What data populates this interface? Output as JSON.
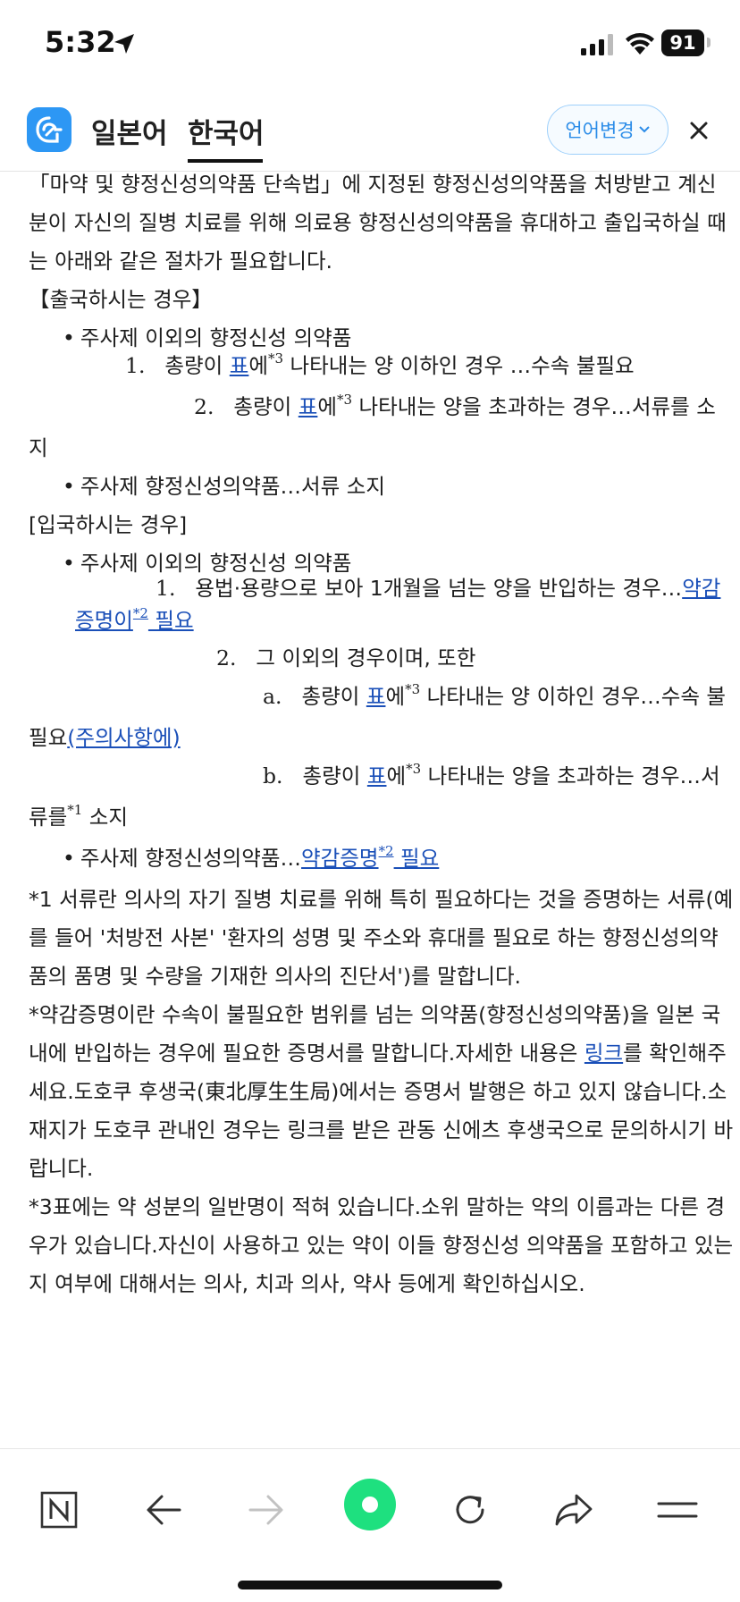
{
  "status_bar": {
    "time": "5:32",
    "battery": "91"
  },
  "header": {
    "tab_japanese": "일본어",
    "tab_korean": "한국어",
    "language_change": "언어변경",
    "colors": {
      "accent": "#2d97f4",
      "link": "#1a4fb8"
    }
  },
  "content": {
    "intro": "「마약 및 향정신성의약품 단속법」에 지정된 향정신성의약품을 처방받고 계신 분이 자신의 질병 치료를 위해 의료용 향정신성의약품을 휴대하고 출입국하실 때는 아래와 같은 절차가 필요합니다.",
    "departure_heading": "【출국하시는 경우】",
    "dep_bullet1": "주사제 이외의 향정신성 의약품",
    "dep_item1_num": "1.",
    "dep_item1_pre": "총량이 ",
    "dep_item1_link": "표",
    "dep_item1_mid": "에",
    "dep_item1_sup": "*3",
    "dep_item1_post": " 나타내는 양 이하인 경우 …수속 불필요",
    "dep_item2_num": "2.",
    "dep_item2_pre": "총량이 ",
    "dep_item2_link": "표",
    "dep_item2_mid": "에",
    "dep_item2_sup": "*3",
    "dep_item2_post": " 나타내는 양을 초과하는 경우…서류를 소지",
    "dep_bullet2": "주사제 향정신성의약품…서류 소지",
    "entry_heading": "[입국하시는 경우]",
    "ent_bullet1": "주사제 이외의 향정신성 의약품",
    "ent_item1_num": "1.",
    "ent_item1_text": "용법·용량으로 보아 1개월을 넘는 양을 반입하는 경우…",
    "ent_item1_link": "약감 증명이",
    "ent_item1_sup": "*2",
    "ent_item1_link2": " 필요",
    "ent_item2_num": "2.",
    "ent_item2_text": "그 이외의 경우이며, 또한",
    "ent_a_num": "a.",
    "ent_a_pre": "총량이 ",
    "ent_a_link": "표",
    "ent_a_mid": "에",
    "ent_a_sup": "*3",
    "ent_a_post": " 나타내는 양 이하인 경우…수속 불필요",
    "ent_a_link2": "(주의사항에)",
    "ent_b_num": "b.",
    "ent_b_pre": "총량이 ",
    "ent_b_link": "표",
    "ent_b_mid": "에",
    "ent_b_sup": "*3",
    "ent_b_post": " 나타내는 양을 초과하는 경우…서류를",
    "ent_b_sup2": "*1",
    "ent_b_end": " 소지",
    "ent_bullet2_pre": "주사제 향정신성의약품…",
    "ent_bullet2_link": "약감증명",
    "ent_bullet2_sup": "*2",
    "ent_bullet2_link2": " 필요",
    "note1": "*1 서류란 의사의 자기 질병 치료를 위해 특히 필요하다는 것을 증명하는 서류(예를 들어 '처방전 사본' '환자의 성명 및 주소와 휴대를 필요로 하는 향정신성의약품의 품명 및 수량을 기재한 의사의 진단서')를 말합니다.",
    "note2_pre": "*약감증명이란 수속이 불필요한 범위를 넘는 의약품(향정신성의약품)을 일본 국내에 반입하는 경우에 필요한 증명서를 말합니다.자세한 내용은 ",
    "note2_link": "링크",
    "note2_post": "를 확인해주세요.도호쿠 후생국(東北厚生生局)에서는 증명서 발행은 하고 있지 않습니다.소재지가 도호쿠 관내인 경우는 링크를 받은 관동 신에츠 후생국으로 문의하시기 바랍니다.",
    "note3": "*3표에는 약 성분의 일반명이 적혀 있습니다.소위 말하는 약의 이름과는 다른 경우가 있습니다.자신이 사용하고 있는 약이 이들 향정신성 의약품을 포함하고 있는지 여부에 대해서는 의사, 치과 의사, 약사 등에게 확인하십시오."
  },
  "toolbar": {
    "icons": [
      "naver-n-icon",
      "back-arrow-icon",
      "forward-arrow-icon",
      "green-dot-icon",
      "refresh-icon",
      "share-icon",
      "menu-icon"
    ],
    "colors": {
      "green": "#1ee07f"
    }
  }
}
